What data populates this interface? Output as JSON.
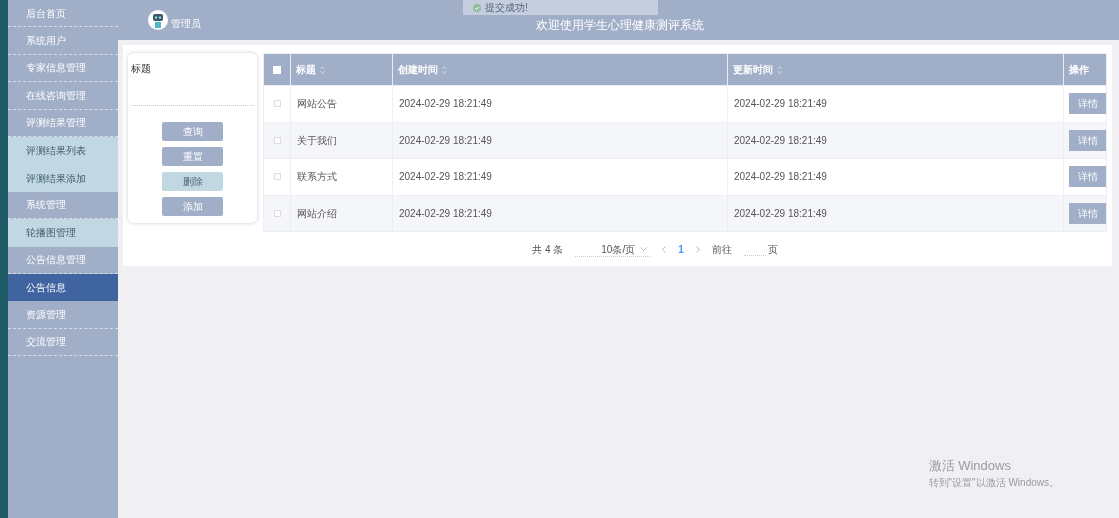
{
  "sidebar": {
    "items": [
      {
        "label": "后台首页",
        "kind": "group",
        "selected": false
      },
      {
        "label": "系统用户",
        "kind": "group",
        "selected": false
      },
      {
        "label": "专家信息管理",
        "kind": "group",
        "selected": false
      },
      {
        "label": "在线咨询管理",
        "kind": "group",
        "selected": false
      },
      {
        "label": "评测结果管理",
        "kind": "group",
        "selected": false
      },
      {
        "label": "评测结果列表",
        "kind": "subitem",
        "selected": false
      },
      {
        "label": "评测结果添加",
        "kind": "subitem",
        "selected": false
      },
      {
        "label": "系统管理",
        "kind": "group",
        "selected": false
      },
      {
        "label": "轮播图管理",
        "kind": "subitem",
        "selected": false
      },
      {
        "label": "公告信息管理",
        "kind": "group",
        "selected": false
      },
      {
        "label": "公告信息",
        "kind": "subitem",
        "selected": true
      },
      {
        "label": "资源管理",
        "kind": "group",
        "selected": false
      },
      {
        "label": "交流管理",
        "kind": "group",
        "selected": false
      }
    ]
  },
  "header": {
    "user": "管理员",
    "title": "欢迎使用学生心理健康测评系统"
  },
  "toast": {
    "message": "提交成功!"
  },
  "search_panel": {
    "field_label": "标题",
    "buttons": [
      {
        "label": "查询",
        "disabled": false
      },
      {
        "label": "重置",
        "disabled": false
      },
      {
        "label": "删除",
        "disabled": true
      },
      {
        "label": "添加",
        "disabled": false
      }
    ]
  },
  "table": {
    "all_checked": false,
    "columns": [
      "标题",
      "创建时间",
      "更新时间",
      "操作"
    ],
    "rows": [
      {
        "checked": false,
        "title": "网站公告",
        "created": "2024-02-29 18:21:49",
        "updated": "2024-02-29 18:21:49",
        "action": "详情"
      },
      {
        "checked": false,
        "title": "关于我们",
        "created": "2024-02-29 18:21:49",
        "updated": "2024-02-29 18:21:49",
        "action": "详情"
      },
      {
        "checked": false,
        "title": "联系方式",
        "created": "2024-02-29 18:21:49",
        "updated": "2024-02-29 18:21:49",
        "action": "详情"
      },
      {
        "checked": false,
        "title": "网站介绍",
        "created": "2024-02-29 18:21:49",
        "updated": "2024-02-29 18:21:49",
        "action": "详情"
      }
    ]
  },
  "pagination": {
    "total": "共 4 条",
    "page_size": "10条/页",
    "current": "1",
    "goto": "前往",
    "page_unit": "页"
  },
  "activation_notice": {
    "title": "激活 Windows",
    "text": "转到\"设置\"以激活 Windows。"
  }
}
